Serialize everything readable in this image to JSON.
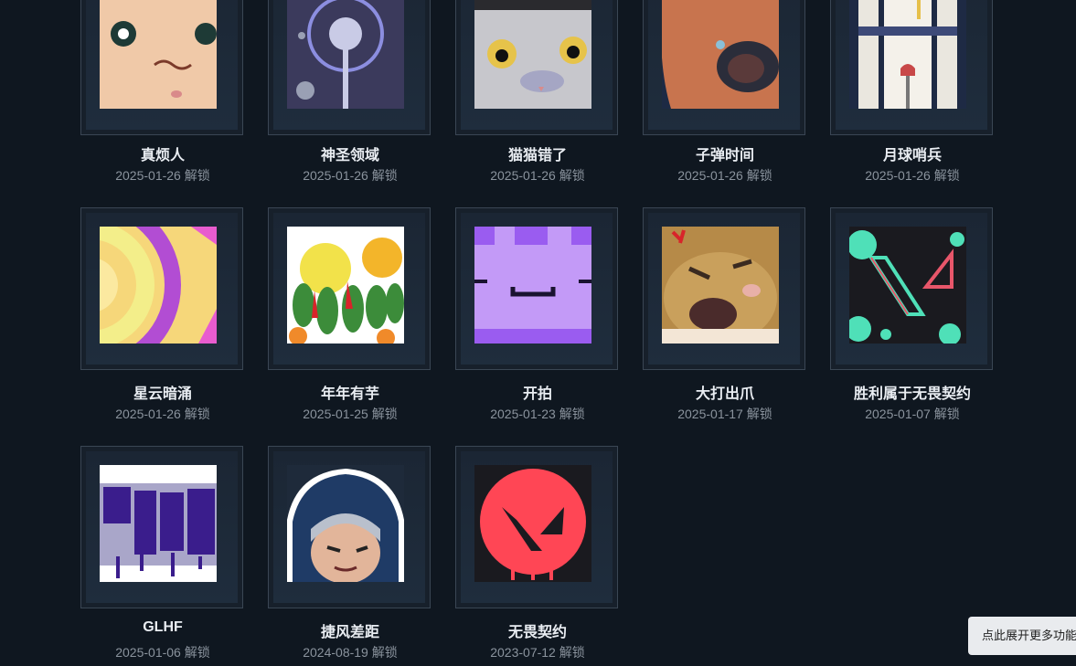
{
  "unlock_suffix": "解锁",
  "cards": [
    {
      "name": "真烦人",
      "date": "2025-01-26",
      "icon": "annoyed-face-icon"
    },
    {
      "name": "神圣领域",
      "date": "2025-01-26",
      "icon": "sacred-orb-icon"
    },
    {
      "name": "猫猫错了",
      "date": "2025-01-26",
      "icon": "cat-icon"
    },
    {
      "name": "子弹时间",
      "date": "2025-01-26",
      "icon": "bullet-time-icon"
    },
    {
      "name": "月球哨兵",
      "date": "2025-01-26",
      "icon": "moon-sentinel-icon"
    },
    {
      "name": "星云暗涌",
      "date": "2025-01-26",
      "icon": "nebula-icon"
    },
    {
      "name": "年年有芋",
      "date": "2025-01-25",
      "icon": "fruit-bowl-icon"
    },
    {
      "name": "开拍",
      "date": "2025-01-23",
      "icon": "purple-ghost-icon"
    },
    {
      "name": "大打出爪",
      "date": "2025-01-17",
      "icon": "angry-cat-icon"
    },
    {
      "name": "胜利属于无畏契约",
      "date": "2025-01-07",
      "icon": "valorant-splash-icon"
    },
    {
      "name": "GLHF",
      "date": "2025-01-06",
      "icon": "graffiti-icon"
    },
    {
      "name": "捷风差距",
      "date": "2024-08-19",
      "icon": "jett-icon"
    },
    {
      "name": "无畏契约",
      "date": "2023-07-12",
      "icon": "valorant-logo-icon"
    }
  ],
  "tooltip": {
    "text": "点此展开更多功能"
  },
  "colors": {
    "background": "#0f1720",
    "frame_border": "#3a4654",
    "accent": "#ff4655"
  }
}
